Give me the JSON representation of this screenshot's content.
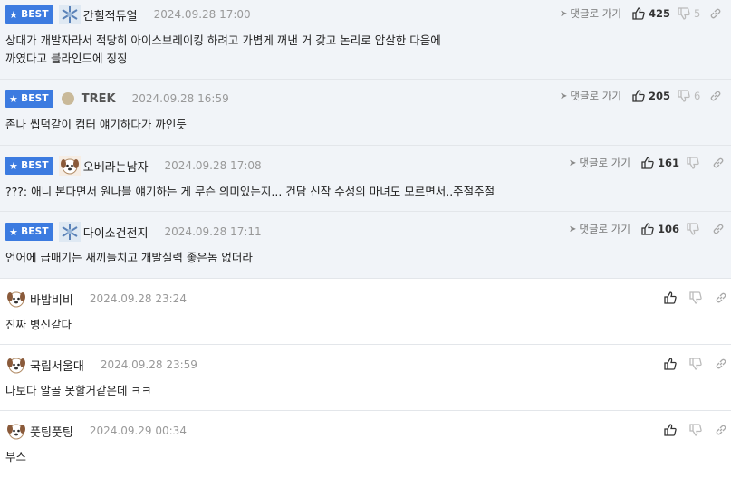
{
  "badge_label": "BEST",
  "reply_label": "댓글로 가기",
  "best_comments": [
    {
      "author": "간힐적듀얼",
      "date": "2024.09.28 17:00",
      "text": "상대가 개발자라서 적당히 아이스브레이킹 하려고 가볍게 꺼낸 거 갖고 논리로 압살한 다음에\n까였다고 블라인드에 징징",
      "likes": "425",
      "dislikes": "5",
      "avatar": "snowflake-icon"
    },
    {
      "author": "TREK",
      "date": "2024.09.28 16:59",
      "text": "존나 씹덕같이 컴터 얘기하다가 까인듯",
      "likes": "205",
      "dislikes": "6",
      "avatar": "dot-icon"
    },
    {
      "author": "오베라는남자",
      "date": "2024.09.28 17:08",
      "text": "???: 애니 본다면서 원나블 얘기하는 게 무슨 의미있는지... 건담 신작 수성의 마녀도 모르면서..주절주절",
      "likes": "161",
      "dislikes": "",
      "avatar": "dog-icon"
    },
    {
      "author": "다이소건전지",
      "date": "2024.09.28 17:11",
      "text": "언어에 급매기는 새끼들치고 개발실력 좋은놈 없더라",
      "likes": "106",
      "dislikes": "",
      "avatar": "snowflake-icon"
    }
  ],
  "comments": [
    {
      "author": "바밥비비",
      "date": "2024.09.28 23:24",
      "text": "진짜 병신같다",
      "avatar": "dog-icon"
    },
    {
      "author": "국립서울대",
      "date": "2024.09.28 23:59",
      "text": "나보다 알골 못할거같은데 ㅋㅋ",
      "avatar": "dog-icon"
    },
    {
      "author": "풋팅풋팅",
      "date": "2024.09.29 00:34",
      "text": "부스",
      "avatar": "dog-icon"
    }
  ],
  "colors": {
    "accent": "#3c7be0",
    "best_bg": "#f1f4f8"
  }
}
